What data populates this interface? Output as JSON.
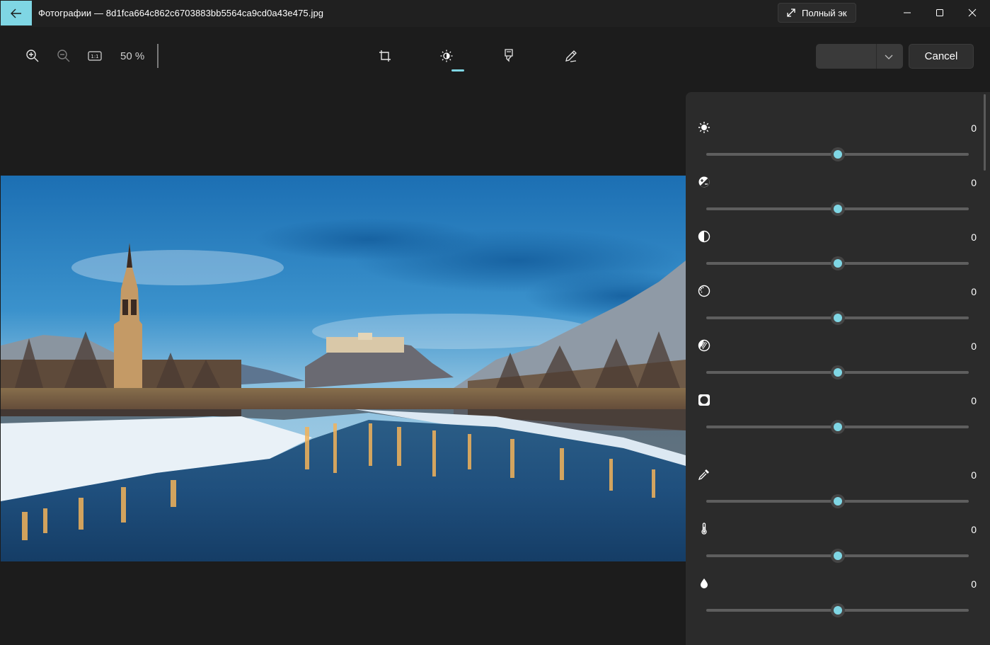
{
  "window": {
    "title": "Фотографии — 8d1fca664c862c6703883bb5564ca9cd0a43e475.jpg",
    "fullscreen_label": "Полный эк",
    "accent_color": "#7fd6e4"
  },
  "toolbar": {
    "zoom_level": "50 %",
    "zoom_in_icon": "zoom-in-icon",
    "zoom_out_icon": "zoom-out-icon",
    "actual_size_icon": "actual-size-icon",
    "edit_tools": [
      "crop-icon",
      "adjust-brightness-icon",
      "filter-marker-icon",
      "markup-pen-icon"
    ],
    "active_tool": "adjust-brightness-icon",
    "cancel_label": "Cancel"
  },
  "adjustments": [
    {
      "icon": "brightness-icon",
      "value": "0",
      "slider_position": 0.5
    },
    {
      "icon": "exposure-icon",
      "value": "0",
      "slider_position": 0.5
    },
    {
      "icon": "contrast-icon",
      "value": "0",
      "slider_position": 0.5
    },
    {
      "icon": "highlights-icon",
      "value": "0",
      "slider_position": 0.5
    },
    {
      "icon": "shadows-icon",
      "value": "0",
      "slider_position": 0.5
    },
    {
      "icon": "vignette-icon",
      "value": "0",
      "slider_position": 0.5
    },
    {
      "icon": "eyedropper-icon",
      "value": "0",
      "slider_position": 0.5
    },
    {
      "icon": "temperature-icon",
      "value": "0",
      "slider_position": 0.5
    },
    {
      "icon": "tint-icon",
      "value": "0",
      "slider_position": 0.5
    }
  ]
}
